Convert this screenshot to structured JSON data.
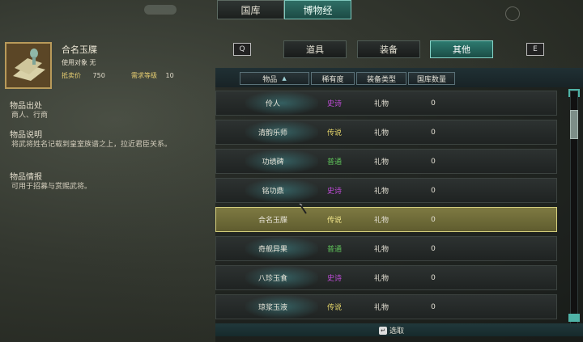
{
  "top_tabs": [
    {
      "label": "国库",
      "active": false
    },
    {
      "label": "博物经",
      "active": true
    }
  ],
  "item": {
    "name": "合名玉牒",
    "use_target_label": "使用对象",
    "use_target_value": "无",
    "price_label": "抵卖价",
    "price_value": "750",
    "level_label": "需求等级",
    "level_value": "10",
    "origin_title": "物品出处",
    "origin_text": "商人、行商",
    "desc_title": "物品说明",
    "desc_text": "将武将姓名记载到皇室族谱之上，拉近君臣关系。",
    "info_title": "物品情报",
    "info_text": "可用于招募与赏赐武将。"
  },
  "category_tabs": [
    {
      "label": "道具",
      "active": false
    },
    {
      "label": "装备",
      "active": false
    },
    {
      "label": "其他",
      "active": true
    }
  ],
  "nav_keys": {
    "left": "Q",
    "right": "E"
  },
  "columns": [
    "物品",
    "稀有度",
    "装备类型",
    "国库数量"
  ],
  "rows": [
    {
      "name": "伶人",
      "rarity": "史诗",
      "rarity_color": "#c04bd8",
      "type": "礼物",
      "qty": "0",
      "selected": false
    },
    {
      "name": "清韵乐师",
      "rarity": "传说",
      "rarity_color": "#e6d66a",
      "type": "礼物",
      "qty": "0",
      "selected": false
    },
    {
      "name": "功绩碑",
      "rarity": "普通",
      "rarity_color": "#5fc35a",
      "type": "礼物",
      "qty": "0",
      "selected": false
    },
    {
      "name": "铭功鼎",
      "rarity": "史诗",
      "rarity_color": "#c04bd8",
      "type": "礼物",
      "qty": "0",
      "selected": false
    },
    {
      "name": "合名玉牒",
      "rarity": "传说",
      "rarity_color": "#f1e58a",
      "type": "礼物",
      "qty": "0",
      "selected": true
    },
    {
      "name": "奇舰异果",
      "rarity": "普通",
      "rarity_color": "#5fc35a",
      "type": "礼物",
      "qty": "0",
      "selected": false
    },
    {
      "name": "八珍玉食",
      "rarity": "史诗",
      "rarity_color": "#c04bd8",
      "type": "礼物",
      "qty": "0",
      "selected": false
    },
    {
      "name": "琼浆玉液",
      "rarity": "传说",
      "rarity_color": "#e6d66a",
      "type": "礼物",
      "qty": "0",
      "selected": false
    }
  ],
  "footer_hint": "选取"
}
